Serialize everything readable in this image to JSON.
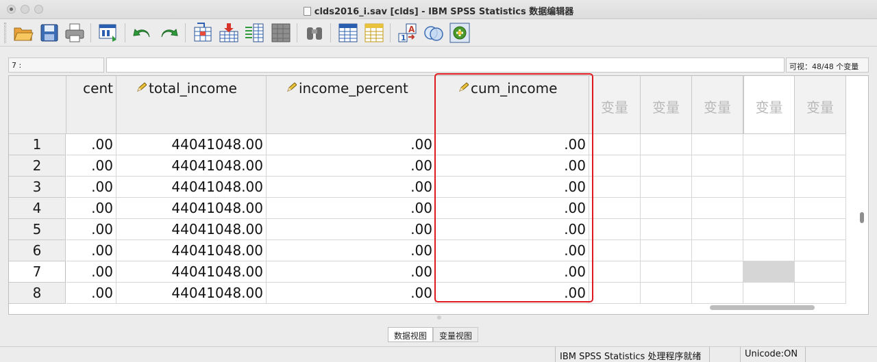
{
  "window": {
    "title": "clds2016_i.sav [clds] - IBM SPSS Statistics 数据编辑器"
  },
  "toolbar": {
    "icons": [
      "open-folder-icon",
      "save-icon",
      "print-icon",
      "dialog-recall-icon",
      "undo-icon",
      "redo-icon",
      "goto-case-icon",
      "goto-variable-icon",
      "variables-icon",
      "split-file-icon",
      "find-icon",
      "insert-case-icon",
      "insert-variable-icon",
      "value-labels-icon",
      "use-sets-icon",
      "spelling-icon"
    ]
  },
  "cell_ref": "7 :",
  "cell_value": "",
  "visible_vars": "可视：48/48 个变量",
  "columns": [
    {
      "name": "cent",
      "icon": false
    },
    {
      "name": "total_income",
      "icon": true
    },
    {
      "name": "income_percent",
      "icon": true
    },
    {
      "name": "cum_income",
      "icon": true
    }
  ],
  "empty_var_label": "变量",
  "empty_var_cols": [
    "变量",
    "变量",
    "变量",
    "变量",
    "变量"
  ],
  "rows": [
    {
      "num": "1",
      "values": [
        ".00",
        "44041048.00",
        ".00",
        ".00"
      ]
    },
    {
      "num": "2",
      "values": [
        ".00",
        "44041048.00",
        ".00",
        ".00"
      ]
    },
    {
      "num": "3",
      "values": [
        ".00",
        "44041048.00",
        ".00",
        ".00"
      ]
    },
    {
      "num": "4",
      "values": [
        ".00",
        "44041048.00",
        ".00",
        ".00"
      ]
    },
    {
      "num": "5",
      "values": [
        ".00",
        "44041048.00",
        ".00",
        ".00"
      ]
    },
    {
      "num": "6",
      "values": [
        ".00",
        "44041048.00",
        ".00",
        ".00"
      ]
    },
    {
      "num": "7",
      "values": [
        ".00",
        "44041048.00",
        ".00",
        ".00"
      ]
    },
    {
      "num": "8",
      "values": [
        ".00",
        "44041048.00",
        ".00",
        ".00"
      ]
    }
  ],
  "active_row": "7",
  "tabs": [
    {
      "label": "数据视图",
      "active": true
    },
    {
      "label": "变量视图",
      "active": false
    }
  ],
  "status": {
    "processor": "IBM SPSS Statistics 处理程序就绪",
    "unicode": "Unicode:ON"
  },
  "colors": {
    "highlight": "#e0191e"
  }
}
